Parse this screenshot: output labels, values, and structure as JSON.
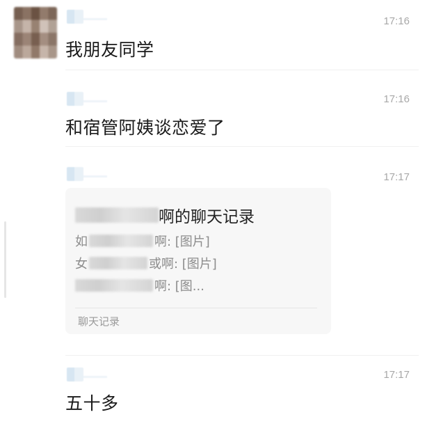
{
  "messages": [
    {
      "time": "17:16",
      "text": "我朋友同学"
    },
    {
      "time": "17:16",
      "text": "和宿管阿姨谈恋爱了"
    },
    {
      "time": "17:17",
      "chat_record": {
        "title_suffix": "啊的聊天记录",
        "lines": [
          {
            "prefix": "如",
            "suffix": "啊: [图片]"
          },
          {
            "prefix": "女",
            "suffix": "或啊: [图片]"
          },
          {
            "prefix": "",
            "suffix": "啊: [图..."
          }
        ],
        "footer": "聊天记录"
      }
    },
    {
      "time": "17:17",
      "text": "五十多"
    }
  ]
}
